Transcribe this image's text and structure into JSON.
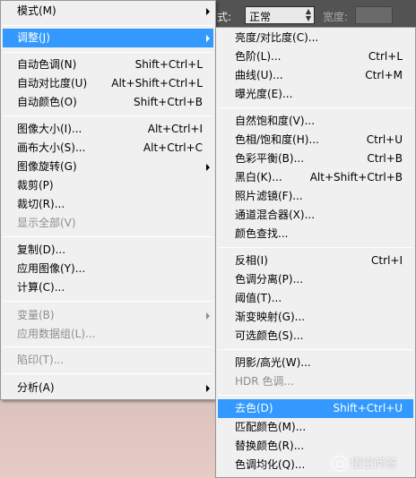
{
  "options_bar": {
    "style_label": "式:",
    "style_value": "正常",
    "width_label": "宽度:"
  },
  "main_menu": {
    "mode": {
      "label": "模式(M)"
    },
    "adjustments": {
      "label": "调整(J)"
    },
    "auto_tone": {
      "label": "自动色调(N)",
      "shortcut": "Shift+Ctrl+L"
    },
    "auto_contrast": {
      "label": "自动对比度(U)",
      "shortcut": "Alt+Shift+Ctrl+L"
    },
    "auto_color": {
      "label": "自动颜色(O)",
      "shortcut": "Shift+Ctrl+B"
    },
    "image_size": {
      "label": "图像大小(I)...",
      "shortcut": "Alt+Ctrl+I"
    },
    "canvas_size": {
      "label": "画布大小(S)...",
      "shortcut": "Alt+Ctrl+C"
    },
    "image_rotation": {
      "label": "图像旋转(G)"
    },
    "crop": {
      "label": "裁剪(P)"
    },
    "trim": {
      "label": "裁切(R)..."
    },
    "reveal_all": {
      "label": "显示全部(V)"
    },
    "duplicate": {
      "label": "复制(D)..."
    },
    "apply_image": {
      "label": "应用图像(Y)..."
    },
    "calculations": {
      "label": "计算(C)..."
    },
    "variables": {
      "label": "变量(B)"
    },
    "apply_data_set": {
      "label": "应用数据组(L)..."
    },
    "trap": {
      "label": "陷印(T)..."
    },
    "analysis": {
      "label": "分析(A)"
    }
  },
  "sub_menu": {
    "brightness_contrast": {
      "label": "亮度/对比度(C)..."
    },
    "levels": {
      "label": "色阶(L)...",
      "shortcut": "Ctrl+L"
    },
    "curves": {
      "label": "曲线(U)...",
      "shortcut": "Ctrl+M"
    },
    "exposure": {
      "label": "曝光度(E)..."
    },
    "vibrance": {
      "label": "自然饱和度(V)..."
    },
    "hue_saturation": {
      "label": "色相/饱和度(H)...",
      "shortcut": "Ctrl+U"
    },
    "color_balance": {
      "label": "色彩平衡(B)...",
      "shortcut": "Ctrl+B"
    },
    "black_white": {
      "label": "黑白(K)...",
      "shortcut": "Alt+Shift+Ctrl+B"
    },
    "photo_filter": {
      "label": "照片滤镜(F)..."
    },
    "channel_mixer": {
      "label": "通道混合器(X)..."
    },
    "color_lookup": {
      "label": "颜色查找..."
    },
    "invert": {
      "label": "反相(I)",
      "shortcut": "Ctrl+I"
    },
    "posterize": {
      "label": "色调分离(P)..."
    },
    "threshold": {
      "label": "阈值(T)..."
    },
    "gradient_map": {
      "label": "渐变映射(G)..."
    },
    "selective_color": {
      "label": "可选颜色(S)..."
    },
    "shadows_highlights": {
      "label": "阴影/高光(W)..."
    },
    "hdr_toning": {
      "label": "HDR 色调..."
    },
    "desaturate": {
      "label": "去色(D)",
      "shortcut": "Shift+Ctrl+U"
    },
    "match_color": {
      "label": "匹配颜色(M)..."
    },
    "replace_color": {
      "label": "替换颜色(R)..."
    },
    "equalize": {
      "label": "色调均化(Q)..."
    }
  },
  "watermark": {
    "text": "悟空问答"
  },
  "colors": {
    "highlight": "#3399ff",
    "menu_bg": "#f0f0f0",
    "disabled_text": "#8d8d8d"
  }
}
